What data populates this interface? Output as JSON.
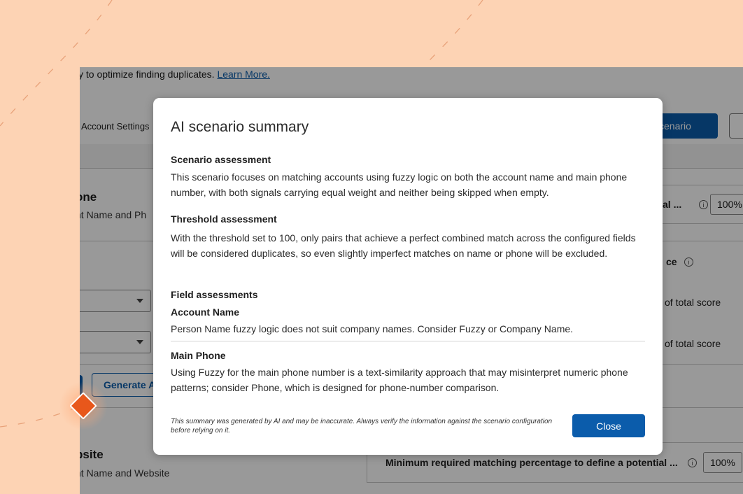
{
  "app": {
    "intro_text": "y to optimize finding duplicates.",
    "intro_link": "Learn More.",
    "tab_label": "Account Settings",
    "scenario_button": "cenario",
    "section1": {
      "title": "one",
      "subtitle": "nt Name and Ph",
      "right_label": "al ...",
      "percent": "100%",
      "confidence_label": "ce",
      "score1": "of total score",
      "score2": "of total score"
    },
    "generate_button": "Generate A",
    "section2": {
      "title": "bsite",
      "subtitle": "nt Name and Website",
      "right_label": "Minimum required matching percentage to define a potential ...",
      "percent": "100%"
    }
  },
  "modal": {
    "title": "AI scenario summary",
    "scenario_heading": "Scenario assessment",
    "scenario_text": "This scenario focuses on matching accounts using fuzzy logic on both the account name and main phone number, with both signals carrying equal weight and neither being skipped when empty.",
    "threshold_heading": "Threshold assessment",
    "threshold_text": "With the threshold set to 100, only pairs that achieve a perfect combined match across the configured fields will be considered duplicates, so even slightly imperfect matches on name or phone will be excluded.",
    "fields_heading": "Field assessments",
    "fields": [
      {
        "name": "Account Name",
        "text": "Person Name fuzzy logic does not suit company names. Consider Fuzzy or Company Name."
      },
      {
        "name": "Main Phone",
        "text": "Using Fuzzy for the main phone number is a text-similarity approach that may misinterpret numeric phone patterns; consider Phone, which is designed for phone-number comparison."
      }
    ],
    "disclaimer": "This summary was generated by AI and may be inaccurate. Always verify the information against the scenario configuration before relying on it.",
    "close_label": "Close"
  },
  "icons": {
    "info": "info-icon",
    "dropdown": "chevron-down-icon",
    "marker": "diamond-marker-icon"
  },
  "colors": {
    "background": "#fdd3b4",
    "accent": "#0b5cab",
    "marker": "#e8571b"
  }
}
